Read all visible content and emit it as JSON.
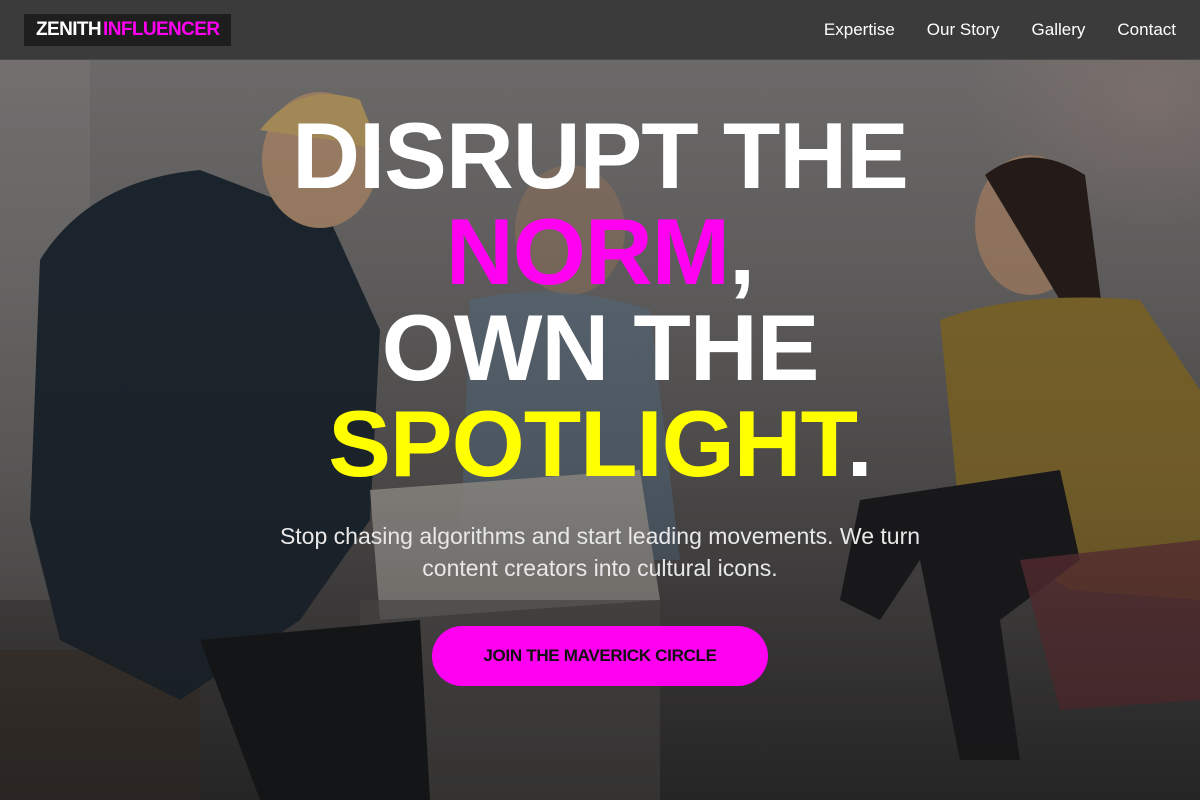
{
  "nav": {
    "logo_primary": "ZENITH",
    "logo_accent": "INFLUENCER",
    "links": [
      "Expertise",
      "Our Story",
      "Gallery",
      "Contact"
    ]
  },
  "hero": {
    "headline": {
      "line1": "DISRUPT THE",
      "line2_accent": "NORM",
      "line2_rest": ",",
      "line3": "OWN THE",
      "line4_accent": "SPOTLIGHT",
      "line4_rest": "."
    },
    "subtext": "Stop chasing algorithms and start leading movements. We turn content creators into cultural icons.",
    "cta_label": "JOIN THE MAVERICK CIRCLE"
  },
  "colors": {
    "accent_pink": "#ff00f0",
    "accent_yellow": "#ffff00",
    "nav_bg": "#3b3b3b"
  }
}
